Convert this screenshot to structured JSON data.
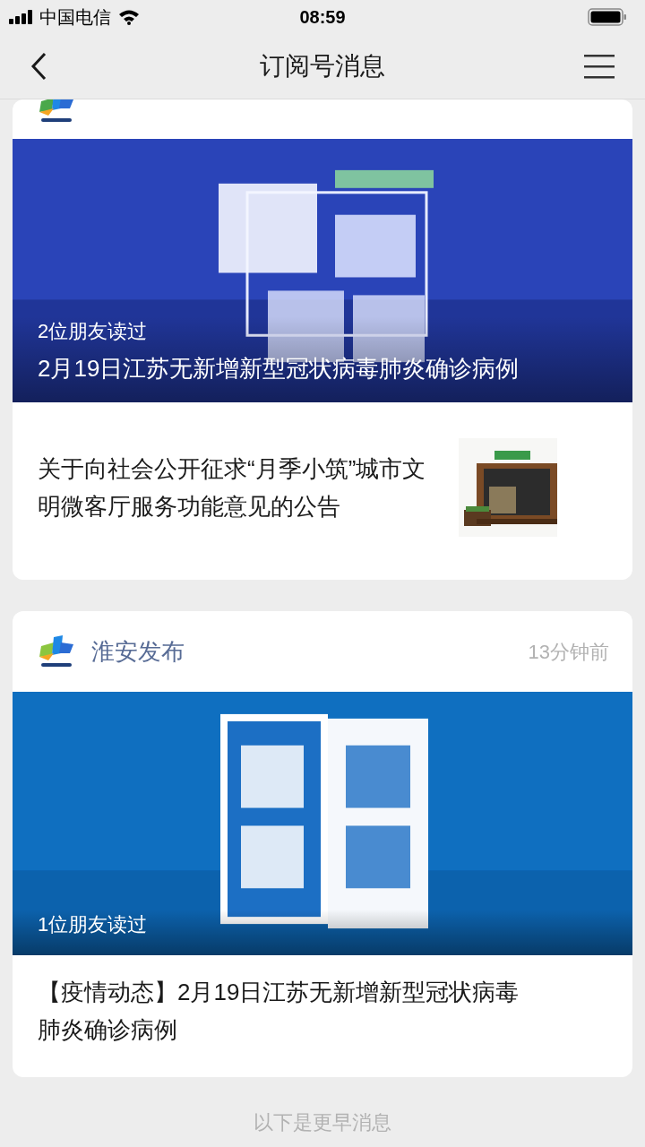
{
  "status_bar": {
    "carrier": "中国电信",
    "time": "08:59"
  },
  "nav": {
    "title": "订阅号消息"
  },
  "cards": [
    {
      "articles": [
        {
          "kind": "cover",
          "read_by": "2位朋友读过",
          "title": "2月19日江苏无新增新型冠状病毒肺炎确诊病例"
        },
        {
          "kind": "row",
          "title": "关于向社会公开征求“月季小筑”城市文明微客厅服务功能意见的公告"
        }
      ]
    },
    {
      "account": "淮安发布",
      "time": "13分钟前",
      "articles": [
        {
          "kind": "cover",
          "read_by": "1位朋友读过"
        },
        {
          "kind": "caption",
          "title": "【疫情动态】2月19日江苏无新增新型冠状病毒肺炎确诊病例"
        }
      ]
    }
  ],
  "footer": "以下是更早消息"
}
